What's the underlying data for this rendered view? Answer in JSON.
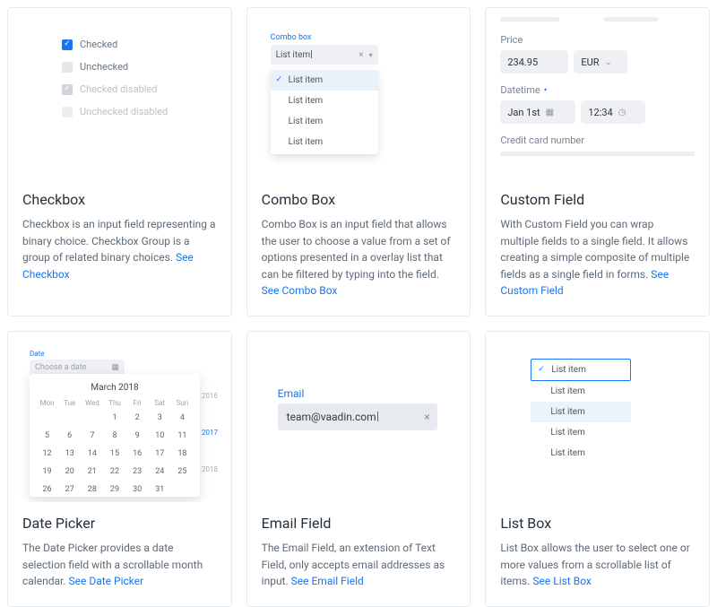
{
  "cards": {
    "checkbox": {
      "title": "Checkbox",
      "desc": "Checkbox is an input field representing a binary choice. Checkbox Group is a group of related binary choices.",
      "link": "See Checkbox",
      "items": [
        "Checked",
        "Unchecked",
        "Checked disabled",
        "Unchecked disabled"
      ]
    },
    "combo": {
      "title": "Combo Box",
      "desc": "Combo Box is an input field that allows the user to choose a value from a set of options presented in a overlay list that can be filtered by typing into the field.",
      "link": "See Combo Box",
      "label": "Combo box",
      "value": "List item",
      "options": [
        "List item",
        "List item",
        "List item",
        "List item"
      ]
    },
    "custom": {
      "title": "Custom Field",
      "desc": "With Custom Field you can wrap multiple fields to a single field. It allows creating a simple composite of multiple fields as a single field in forms.",
      "link": "See Custom Field",
      "price_label": "Price",
      "price_value": "234.95",
      "currency": "EUR",
      "datetime_label": "Datetime",
      "date_value": "Jan 1st",
      "time_value": "12:34",
      "cc_label": "Credit card number"
    },
    "date": {
      "title": "Date Picker",
      "desc": "The Date Picker provides a date selection field with a scrollable month calendar.",
      "link": "See Date Picker",
      "label": "Date",
      "placeholder": "Choose a date",
      "month": "March 2018",
      "years": [
        "2016",
        "2017",
        "2018"
      ],
      "dow": [
        "Mon",
        "Tue",
        "Wed",
        "Thu",
        "Fri",
        "Sat",
        "Sun"
      ],
      "grid": [
        "",
        "",
        "",
        "1",
        "2",
        "3",
        "4",
        "5",
        "6",
        "7",
        "8",
        "9",
        "10",
        "11",
        "12",
        "13",
        "14",
        "15",
        "16",
        "17",
        "18",
        "19",
        "20",
        "21",
        "22",
        "23",
        "24",
        "25",
        "26",
        "27",
        "28",
        "29",
        "30",
        "31",
        ""
      ]
    },
    "email": {
      "title": "Email Field",
      "desc": "The Email Field, an extension of Text Field, only accepts email addresses as input.",
      "link": "See Email Field",
      "label": "Email",
      "value": "team@vaadin.com"
    },
    "listbox": {
      "title": "List Box",
      "desc": "List Box allows the user to select one or more values from a scrollable list of items.",
      "link": "See List Box",
      "items": [
        "List item",
        "List item",
        "List item",
        "List item",
        "List item"
      ]
    }
  }
}
